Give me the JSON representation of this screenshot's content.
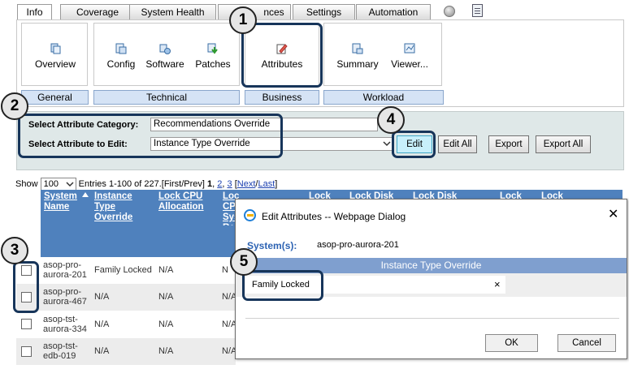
{
  "tabs": [
    "Info",
    "Coverage",
    "System Health",
    "Recommendations",
    "Settings",
    "Automation"
  ],
  "tab_visible_label_4": "nces",
  "ribbon": {
    "buttons": {
      "overview": "Overview",
      "config": "Config",
      "software": "Software",
      "patches": "Patches",
      "attributes": "Attributes",
      "summary": "Summary",
      "viewer": "Viewer..."
    },
    "groups": [
      "General",
      "Technical",
      "Business",
      "Workload"
    ]
  },
  "attribute_panel": {
    "category_label": "Select Attribute Category:",
    "category_value": "Recommendations Override",
    "attribute_label": "Select Attribute to Edit:",
    "attribute_value": "Instance Type Override",
    "buttons": {
      "edit": "Edit",
      "edit_all": "Edit All",
      "export": "Export",
      "export_all": "Export All"
    }
  },
  "paging": {
    "show": "Show",
    "page_size": "100",
    "entries": "Entries 1-100 of 227.",
    "first_prev": "[First/Prev]",
    "page1": "1",
    "comma1": ",",
    "page2": "2",
    "comma2": ",",
    "page3": "3",
    "open": "[",
    "next": "Next",
    "slash": "/",
    "last": "Last",
    "close": "]"
  },
  "grid": {
    "headers": {
      "system_name": "System Name",
      "instance_type": "Instance Type Override",
      "lock_cpu_alloc": "Lock CPU Allocation",
      "lock_cpu_sys": "Lock CPU Sys Re",
      "lock": "Lock",
      "lock_disk": "Lock Disk",
      "lock_disk2": "Lock Disk",
      "lock2": "Lock",
      "lock3": "Lock"
    },
    "rows": [
      {
        "name": "asop-pro-aurora-201",
        "instance": "Family Locked",
        "cpu": "N/A",
        "n4": "N"
      },
      {
        "name": "asop-pro-aurora-467",
        "instance": "N/A",
        "cpu": "N/A",
        "n4": "N/A"
      },
      {
        "name": "asop-tst-aurora-334",
        "instance": "N/A",
        "cpu": "N/A",
        "n4": "N/A"
      },
      {
        "name": "asop-tst-edb-019",
        "instance": "N/A",
        "cpu": "N/A",
        "n4": "N/A"
      }
    ]
  },
  "dialog": {
    "title": "Edit Attributes -- Webpage Dialog",
    "systems_label": "System(s):",
    "systems_value": "asop-pro-aurora-201",
    "column_header": "Instance Type Override",
    "field_value": "Family Locked",
    "clear_symbol": "×",
    "close_symbol": "✕",
    "ok": "OK",
    "cancel": "Cancel"
  },
  "callouts": [
    "1",
    "2",
    "3",
    "4",
    "5"
  ],
  "colors": {
    "grid_header": "#4f81bd",
    "dialog_band": "#7f9fcf",
    "group_label_bg": "#d5e3f5",
    "panel_bg": "#dfe8e8",
    "highlight_border": "#17355a",
    "edit_button_bg": "#c8f0fb"
  }
}
